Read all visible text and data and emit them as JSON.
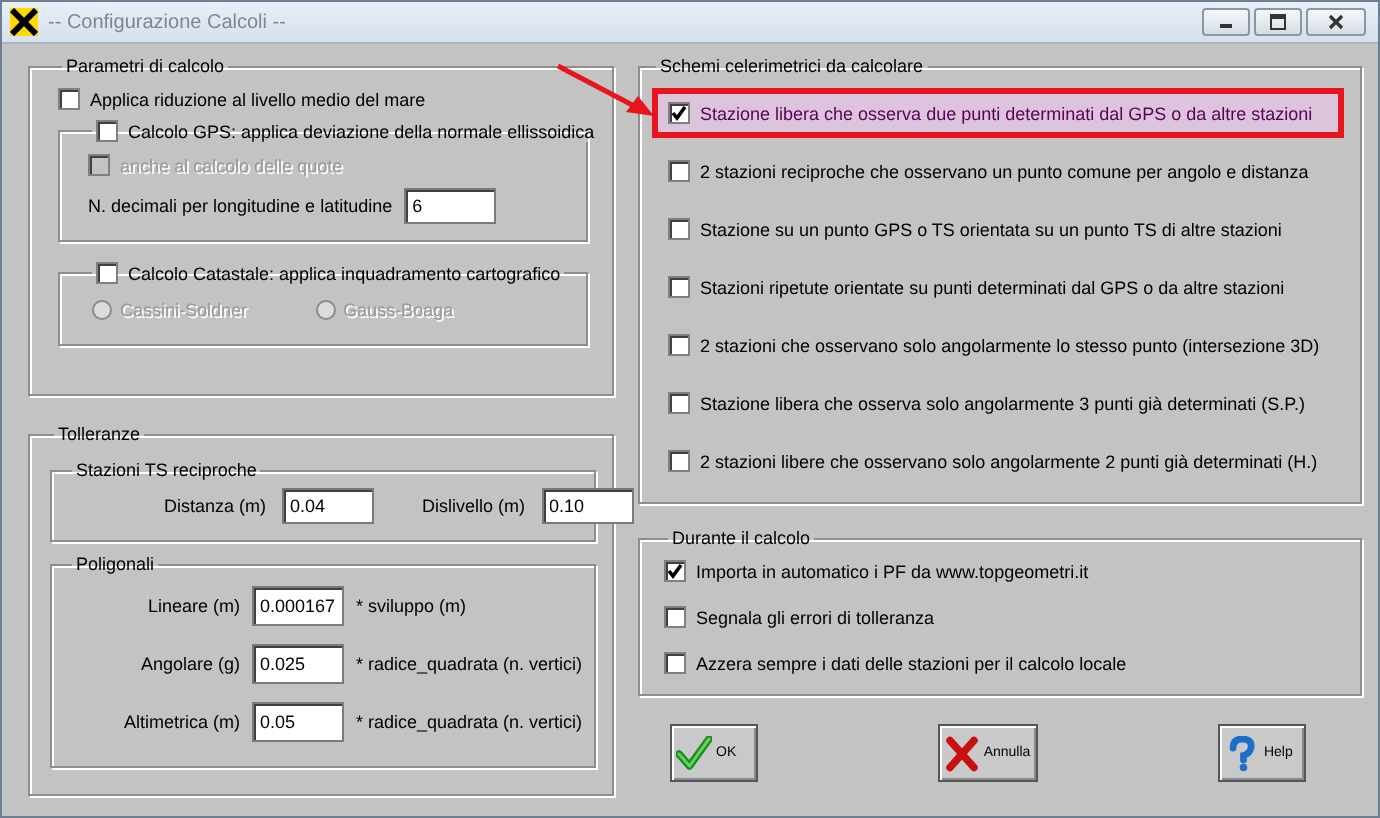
{
  "window": {
    "title": "-- Configurazione Calcoli --"
  },
  "parametri": {
    "title": "Parametri di calcolo",
    "sea_level": {
      "label": "Applica riduzione al livello medio del mare",
      "checked": false
    },
    "gps": {
      "label": "Calcolo GPS: applica deviazione della normale ellissoidica",
      "checked": false,
      "heights": {
        "label": "anche al calcolo delle quote",
        "checked": false,
        "disabled": true
      },
      "decimals": {
        "label": "N. decimali per longitudine e latitudine",
        "value": "6"
      }
    },
    "catastale": {
      "label": "Calcolo Catastale: applica inquadramento cartografico",
      "checked": false,
      "options": [
        {
          "label": "Cassini-Soldner",
          "selected": false,
          "disabled": true
        },
        {
          "label": "Gauss-Boaga",
          "selected": false,
          "disabled": true
        }
      ]
    }
  },
  "tolleranze": {
    "title": "Tolleranze",
    "reciproche": {
      "title": "Stazioni TS reciproche",
      "fields": [
        {
          "label": "Distanza (m)",
          "value": "0.04"
        },
        {
          "label": "Dislivello (m)",
          "value": "0.10"
        }
      ]
    },
    "poligonali": {
      "title": "Poligonali",
      "rows": [
        {
          "label": "Lineare (m)",
          "value": "0.000167",
          "suffix": "* sviluppo (m)"
        },
        {
          "label": "Angolare (g)",
          "value": "0.025",
          "suffix": "* radice_quadrata (n. vertici)"
        },
        {
          "label": "Altimetrica (m)",
          "value": "0.05",
          "suffix": "* radice_quadrata (n. vertici)"
        }
      ]
    }
  },
  "schemi": {
    "title": "Schemi celerimetrici da calcolare",
    "items": [
      {
        "label": "Stazione libera che osserva due punti determinati dal GPS o da altre stazioni",
        "checked": true,
        "selected": true
      },
      {
        "label": "2 stazioni reciproche che osservano un punto comune per angolo e distanza",
        "checked": false,
        "selected": false
      },
      {
        "label": "Stazione su un punto GPS o TS orientata su un punto TS di altre stazioni",
        "checked": false,
        "selected": false
      },
      {
        "label": "Stazioni ripetute orientate su punti determinati dal GPS o da altre stazioni",
        "checked": false,
        "selected": false
      },
      {
        "label": "2 stazioni che osservano solo angolarmente lo stesso punto (intersezione 3D)",
        "checked": false,
        "selected": false
      },
      {
        "label": "Stazione libera che osserva solo angolarmente 3 punti  già determinati (S.P.)",
        "checked": false,
        "selected": false
      },
      {
        "label": "2 stazioni libere che osservano solo angolarmente 2 punti già determinati  (H.)",
        "checked": false,
        "selected": false
      }
    ]
  },
  "durante": {
    "title": "Durante il calcolo",
    "items": [
      {
        "label": "Importa in automatico i PF da www.topgeometri.it",
        "checked": true
      },
      {
        "label": "Segnala gli errori di tolleranza",
        "checked": false
      },
      {
        "label": "Azzera sempre i dati delle stazioni per il calcolo locale",
        "checked": false
      }
    ]
  },
  "buttons": [
    {
      "label": "OK",
      "kind": "ok"
    },
    {
      "label": "Annulla",
      "kind": "cancel"
    },
    {
      "label": "Help",
      "kind": "help"
    }
  ]
}
